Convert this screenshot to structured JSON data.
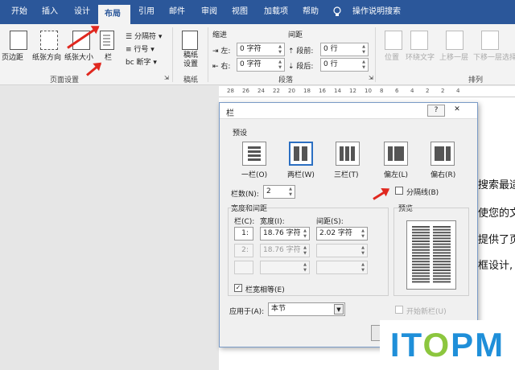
{
  "tabs": [
    "开始",
    "插入",
    "设计",
    "布局",
    "引用",
    "邮件",
    "审阅",
    "视图",
    "加载项",
    "帮助"
  ],
  "tell_me": "操作说明搜索",
  "ribbon": {
    "margins": "页边距",
    "orientation": "纸张方向",
    "size": "纸张大小",
    "columns": "栏",
    "breaks": "分隔符",
    "line_numbers": "行号",
    "hyphenation": "断字",
    "page_setup_group": "页面设置",
    "draft_btn": "稿纸设置",
    "draft_group": "稿纸",
    "indent": "缩进",
    "spacing": "间距",
    "left": "左:",
    "right": "右:",
    "before": "段前:",
    "after": "段后:",
    "indent_left_value": "0 字符",
    "indent_right_value": "0 字符",
    "spacing_before_value": "0 行",
    "spacing_after_value": "0 行",
    "paragraph_group": "段落",
    "position": "位置",
    "wrap_text": "环绕文字",
    "bring_forward": "上移一层",
    "send_backward": "下移一层",
    "selection_pane": "选择",
    "arrange_group": "排列"
  },
  "ruler": [
    "28",
    "26",
    "24",
    "22",
    "20",
    "18",
    "16",
    "14",
    "12",
    "10",
    "8",
    "6",
    "4",
    "2",
    "2",
    "4"
  ],
  "document": {
    "lines": [
      "搜索最适",
      "使您的文",
      "提供了页",
      "框设计,"
    ]
  },
  "dialog": {
    "title": "栏",
    "help": "?",
    "close": "✕",
    "presets_label": "预设",
    "presets": [
      "一栏(O)",
      "两栏(W)",
      "三栏(T)",
      "偏左(L)",
      "偏右(R)"
    ],
    "num_columns_label": "栏数(N):",
    "num_columns_value": "2",
    "separator_label": "分隔线(B)",
    "width_spacing_label": "宽度和间距",
    "col_header": "栏(C):",
    "width_header": "宽度(I):",
    "spacing_header": "间距(S):",
    "rows": [
      {
        "col": "1:",
        "width": "18.76 字符",
        "spacing": "2.02 字符"
      },
      {
        "col": "2:",
        "width": "18.76 字符",
        "spacing": ""
      },
      {
        "col": "",
        "width": "",
        "spacing": ""
      }
    ],
    "equal_width_label": "栏宽相等(E)",
    "preview_label": "预览",
    "apply_to_label": "应用于(A):",
    "apply_to_value": "本节",
    "new_column_label": "开始新栏(U)"
  },
  "watermark": {
    "text": "ITOPM",
    "brand_color": "#1f8fd9",
    "accent_color": "#8cc63e"
  },
  "colors": {
    "ribbon_blue": "#2b579a",
    "arrow_red": "#e0281f",
    "selection_blue": "#2b6fc2"
  }
}
